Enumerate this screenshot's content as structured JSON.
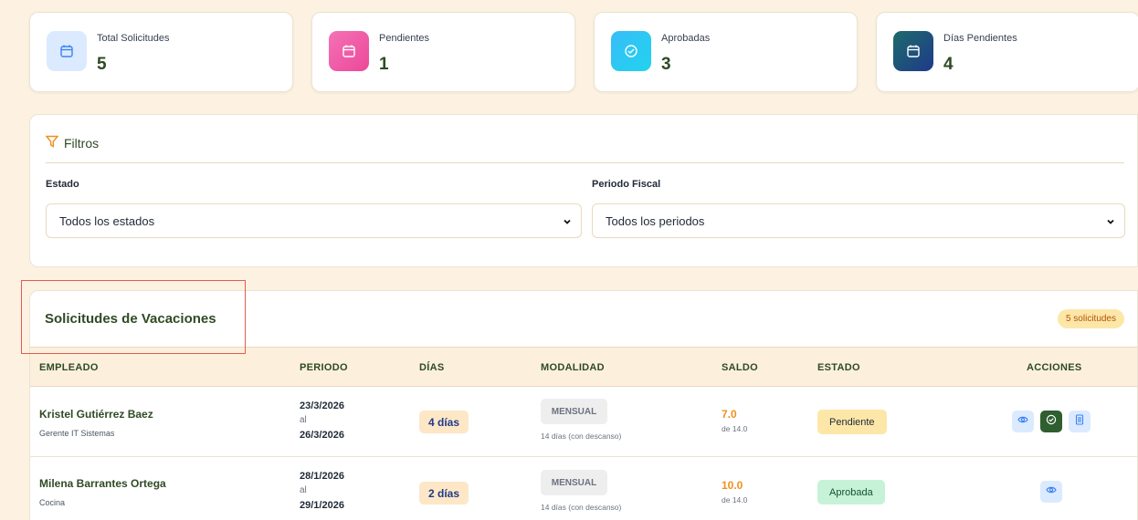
{
  "stats": [
    {
      "label": "Total Solicitudes",
      "value": "5",
      "icon": "calendar-icon",
      "color": "#dbeafe"
    },
    {
      "label": "Pendientes",
      "value": "1",
      "icon": "calendar-icon",
      "color": "#f472b6"
    },
    {
      "label": "Aprobadas",
      "value": "3",
      "icon": "check-circle-icon",
      "color": "#38bdf8"
    },
    {
      "label": "Días Pendientes",
      "value": "4",
      "icon": "calendar-icon",
      "color": "#1e5a63"
    }
  ],
  "filters": {
    "title": "Filtros",
    "estado_label": "Estado",
    "estado_value": "Todos los estados",
    "periodo_label": "Periodo Fiscal",
    "periodo_value": "Todos los periodos"
  },
  "table": {
    "title": "Solicitudes de Vacaciones",
    "count_badge": "5 solicitudes",
    "columns": [
      "EMPLEADO",
      "PERIODO",
      "DÍAS",
      "MODALIDAD",
      "SALDO",
      "ESTADO",
      "ACCIONES"
    ],
    "rows": [
      {
        "name": "Kristel Gutiérrez Baez",
        "role": "Gerente IT Sistemas",
        "from": "23/3/2026",
        "al": "al",
        "to": "26/3/2026",
        "days": "4 días",
        "mode": "MENSUAL",
        "mode_desc": "14 días (con descanso)",
        "saldo": "7.0",
        "saldo_max": "de 14.0",
        "status": "Pendiente"
      },
      {
        "name": "Milena Barrantes Ortega",
        "role": "Cocina",
        "from": "28/1/2026",
        "al": "al",
        "to": "29/1/2026",
        "days": "2 días",
        "mode": "MENSUAL",
        "mode_desc": "14 días (con descanso)",
        "saldo": "10.0",
        "saldo_max": "de 14.0",
        "status": "Aprobada"
      }
    ]
  },
  "colors": {
    "accent": "#2f4a24",
    "warning": "#f0901e",
    "background": "#fdf2e2"
  }
}
